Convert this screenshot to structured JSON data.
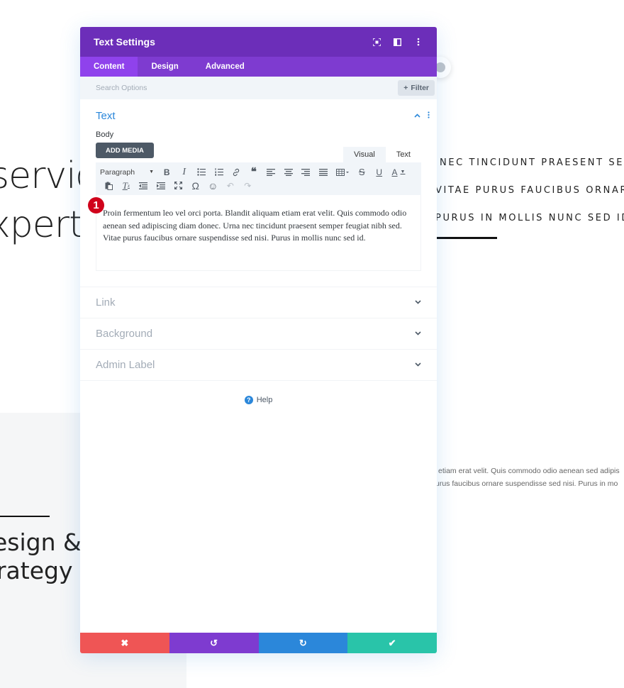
{
  "background": {
    "heading_lines": [
      "servic",
      "xpert"
    ],
    "sub_lines": [
      "esign &",
      "rrategy"
    ],
    "caps_lines": [
      "NEC TINCIDUNT PRAESENT SEMPE",
      "VITAE PURUS FAUCIBUS ORNARE S",
      "PURUS IN MOLLIS NUNC SED ID."
    ],
    "para_lines": [
      "etiam erat velit. Quis commodo odio aenean sed adipis",
      "urus faucibus ornare suspendisse sed nisi. Purus in mo"
    ]
  },
  "modal": {
    "title": "Text Settings",
    "header_icons": [
      "focus-icon",
      "split-view-icon",
      "more-vertical-icon"
    ],
    "tabs": [
      {
        "label": "Content",
        "active": true
      },
      {
        "label": "Design",
        "active": false
      },
      {
        "label": "Advanced",
        "active": false
      }
    ],
    "search": {
      "placeholder": "Search Options",
      "value": ""
    },
    "filter_label": "Filter",
    "text_section": {
      "title": "Text",
      "body_label": "Body",
      "add_media_label": "ADD MEDIA",
      "mode_tabs": [
        "Visual",
        "Text"
      ],
      "format_select": "Paragraph",
      "toolbar_row1": [
        "bold",
        "italic",
        "bullet-list",
        "numbered-list",
        "link",
        "blockquote",
        "align-left",
        "align-center",
        "align-right",
        "align-justify",
        "table",
        "strikethrough",
        "underline",
        "text-color"
      ],
      "toolbar_row2": [
        "paste-text",
        "clear-formatting",
        "outdent",
        "indent",
        "fullscreen",
        "special-character",
        "emoji",
        "undo",
        "redo"
      ],
      "badge_number": "1",
      "body_text": "Proin fermentum leo vel orci porta. Blandit aliquam etiam erat velit. Quis commodo odio aenean sed adipiscing diam donec. Urna nec tincidunt praesent semper feugiat nibh sed. Vitae purus faucibus ornare suspendisse sed nisi. Purus in mollis nunc sed id."
    },
    "collapsed_sections": [
      "Link",
      "Background",
      "Admin Label"
    ],
    "help_label": "Help",
    "footer": {
      "buttons": [
        {
          "name": "cancel",
          "icon": "✖",
          "color": "#ef5555"
        },
        {
          "name": "undo",
          "icon": "↺",
          "color": "#7e3bd0"
        },
        {
          "name": "redo",
          "icon": "↻",
          "color": "#2b87da"
        },
        {
          "name": "save",
          "icon": "✔",
          "color": "#29c4a9"
        }
      ]
    }
  },
  "colors": {
    "header": "#6c2eb9",
    "tabs": "#7e3bd0",
    "active_tab": "#8f42ec",
    "accent_blue": "#2b87da"
  }
}
